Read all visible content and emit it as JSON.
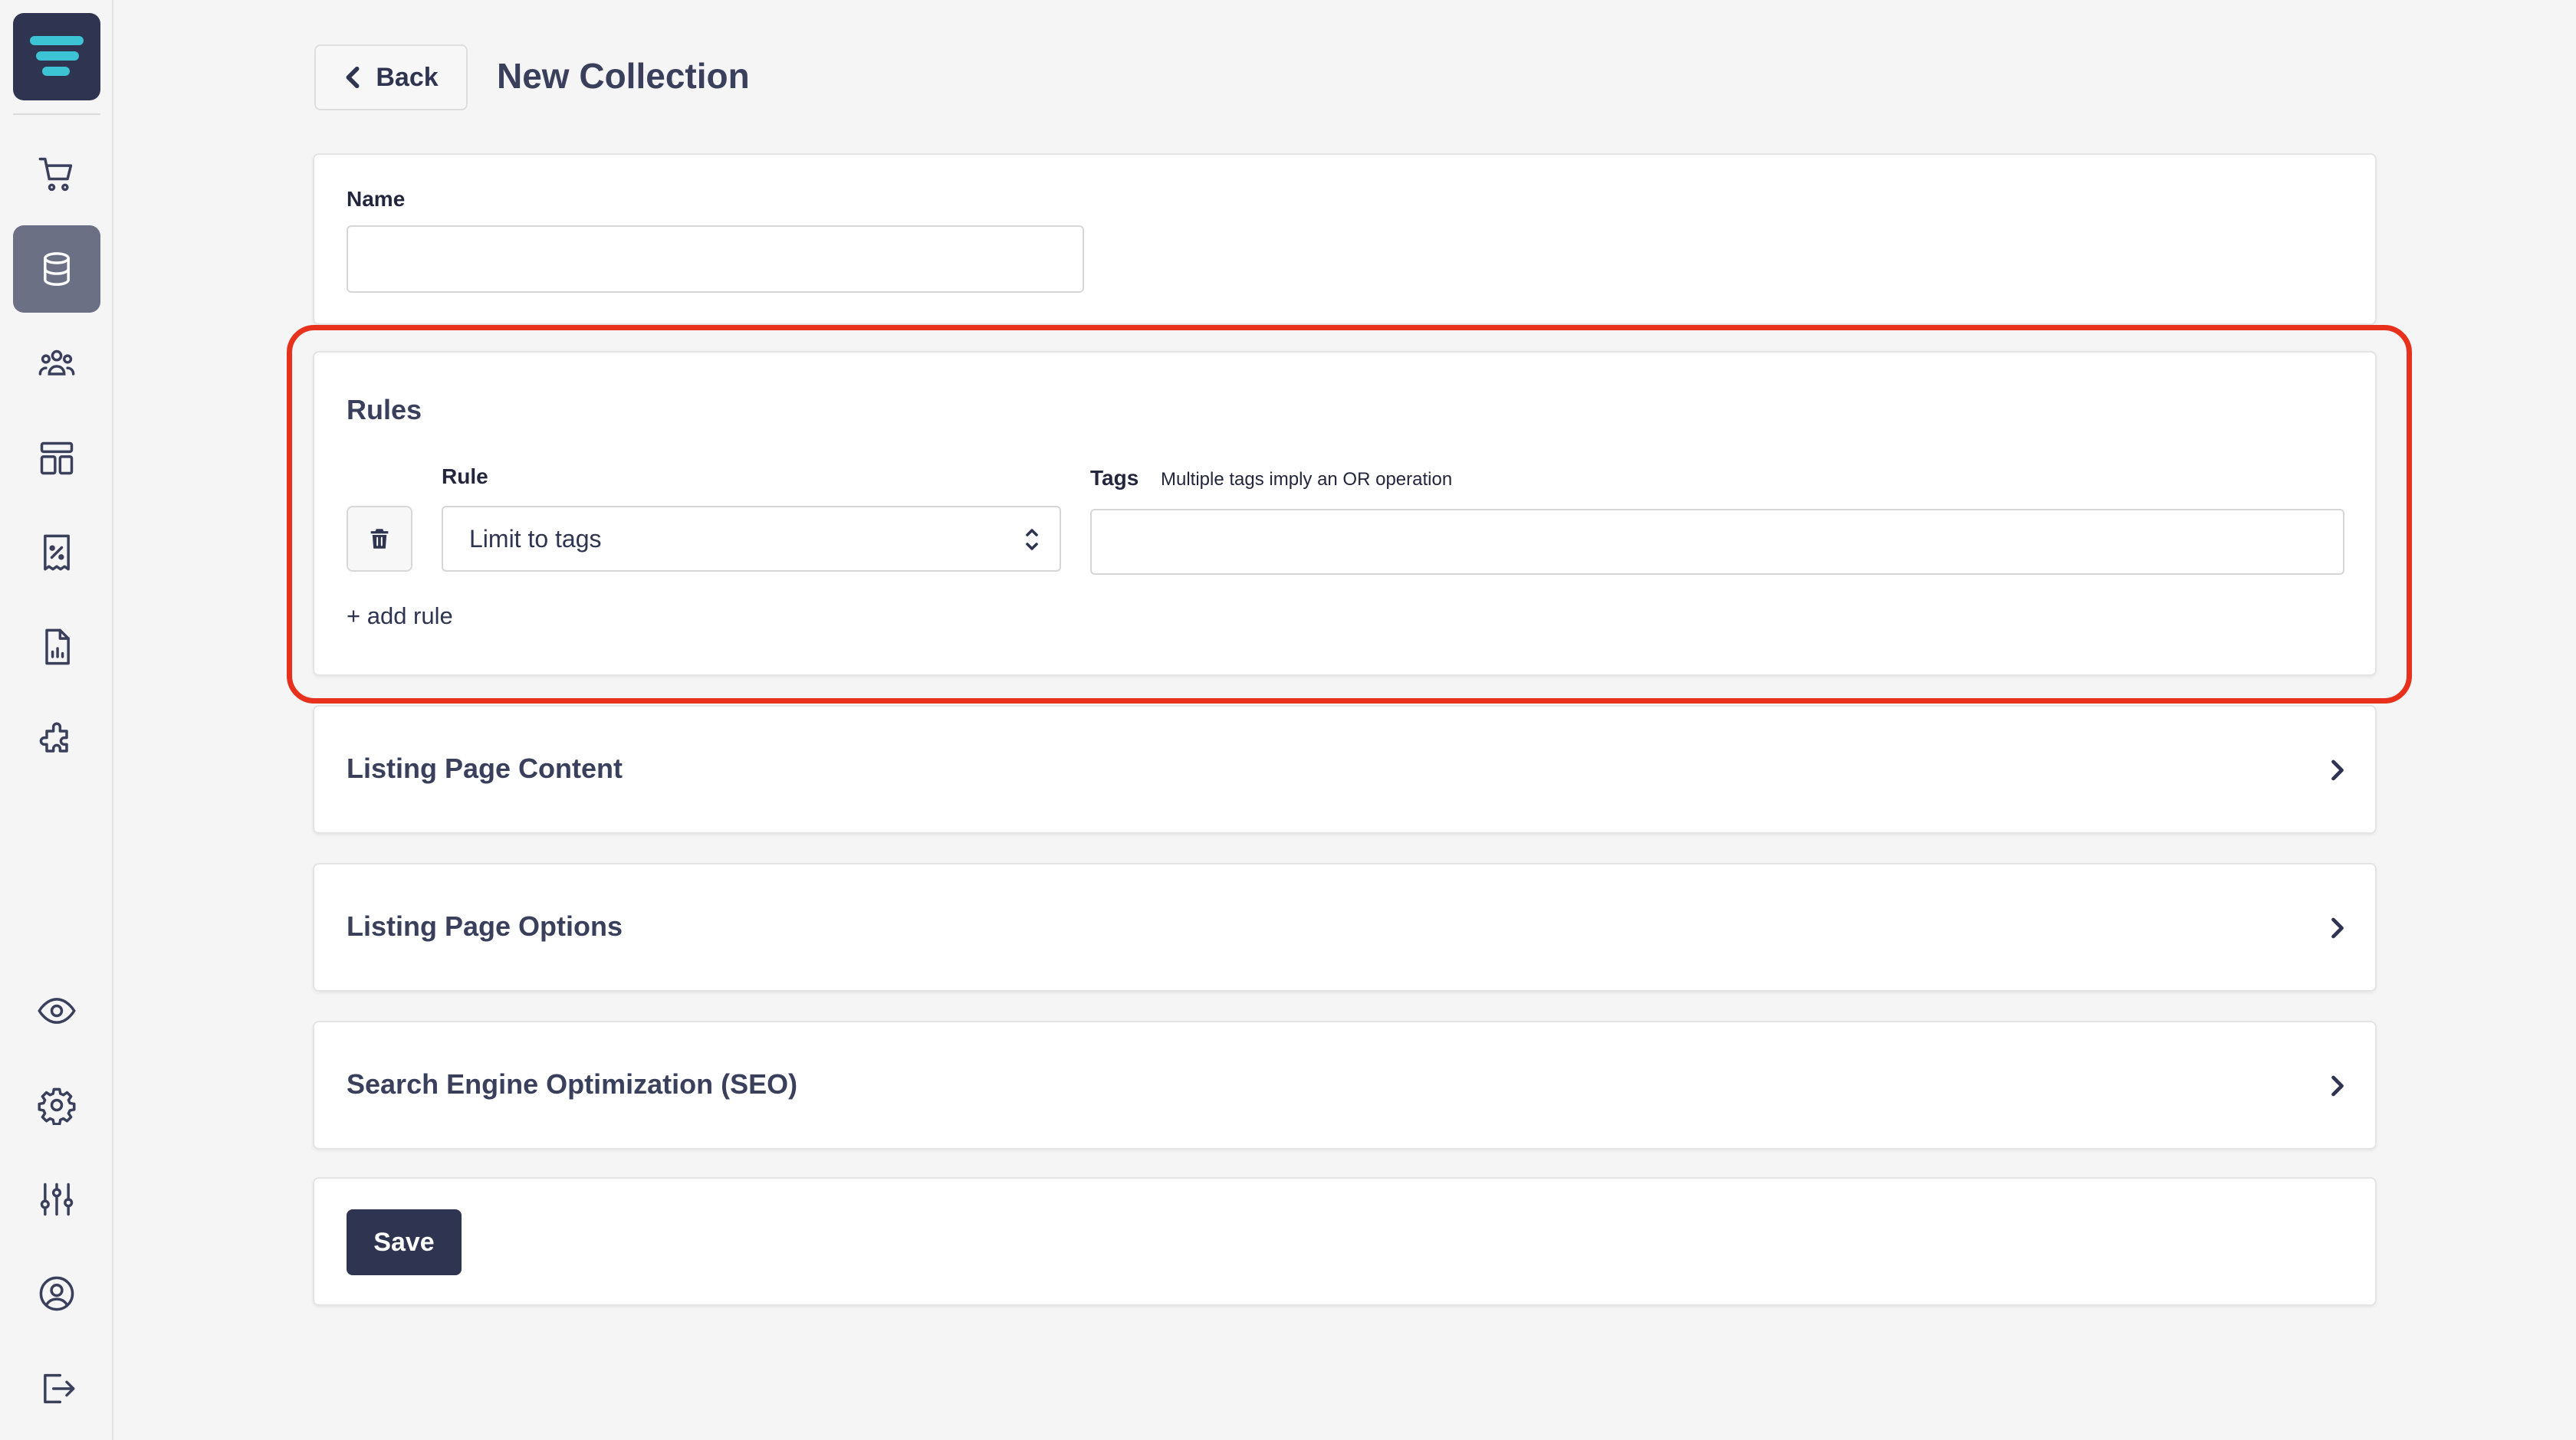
{
  "sidebar": {
    "logo_icon": "stacked-bars-logo",
    "items": [
      {
        "icon": "cart-icon"
      },
      {
        "icon": "database-icon",
        "active": true
      },
      {
        "icon": "customers-icon"
      },
      {
        "icon": "layout-icon"
      },
      {
        "icon": "discount-receipt-icon"
      },
      {
        "icon": "report-icon"
      },
      {
        "icon": "puzzle-icon"
      }
    ],
    "bottom_items": [
      {
        "icon": "eye-icon"
      },
      {
        "icon": "gear-icon"
      },
      {
        "icon": "sliders-icon"
      },
      {
        "icon": "user-circle-icon"
      },
      {
        "icon": "logout-icon"
      }
    ]
  },
  "header": {
    "back_label": "Back",
    "title": "New Collection"
  },
  "name_card": {
    "label": "Name",
    "value": ""
  },
  "rules_card": {
    "title": "Rules",
    "rule_label": "Rule",
    "rule_value": "Limit to tags",
    "tags_label": "Tags",
    "tags_hint": "Multiple tags imply an OR operation",
    "tags_value": "",
    "add_rule_label": "+ add rule"
  },
  "sections": [
    {
      "title": "Listing Page Content"
    },
    {
      "title": "Listing Page Options"
    },
    {
      "title": "Search Engine Optimization (SEO)"
    }
  ],
  "save_label": "Save",
  "colors": {
    "primary": "#2f3450",
    "highlight": "#e8311c",
    "logo_accent": "#3cc4d4"
  }
}
